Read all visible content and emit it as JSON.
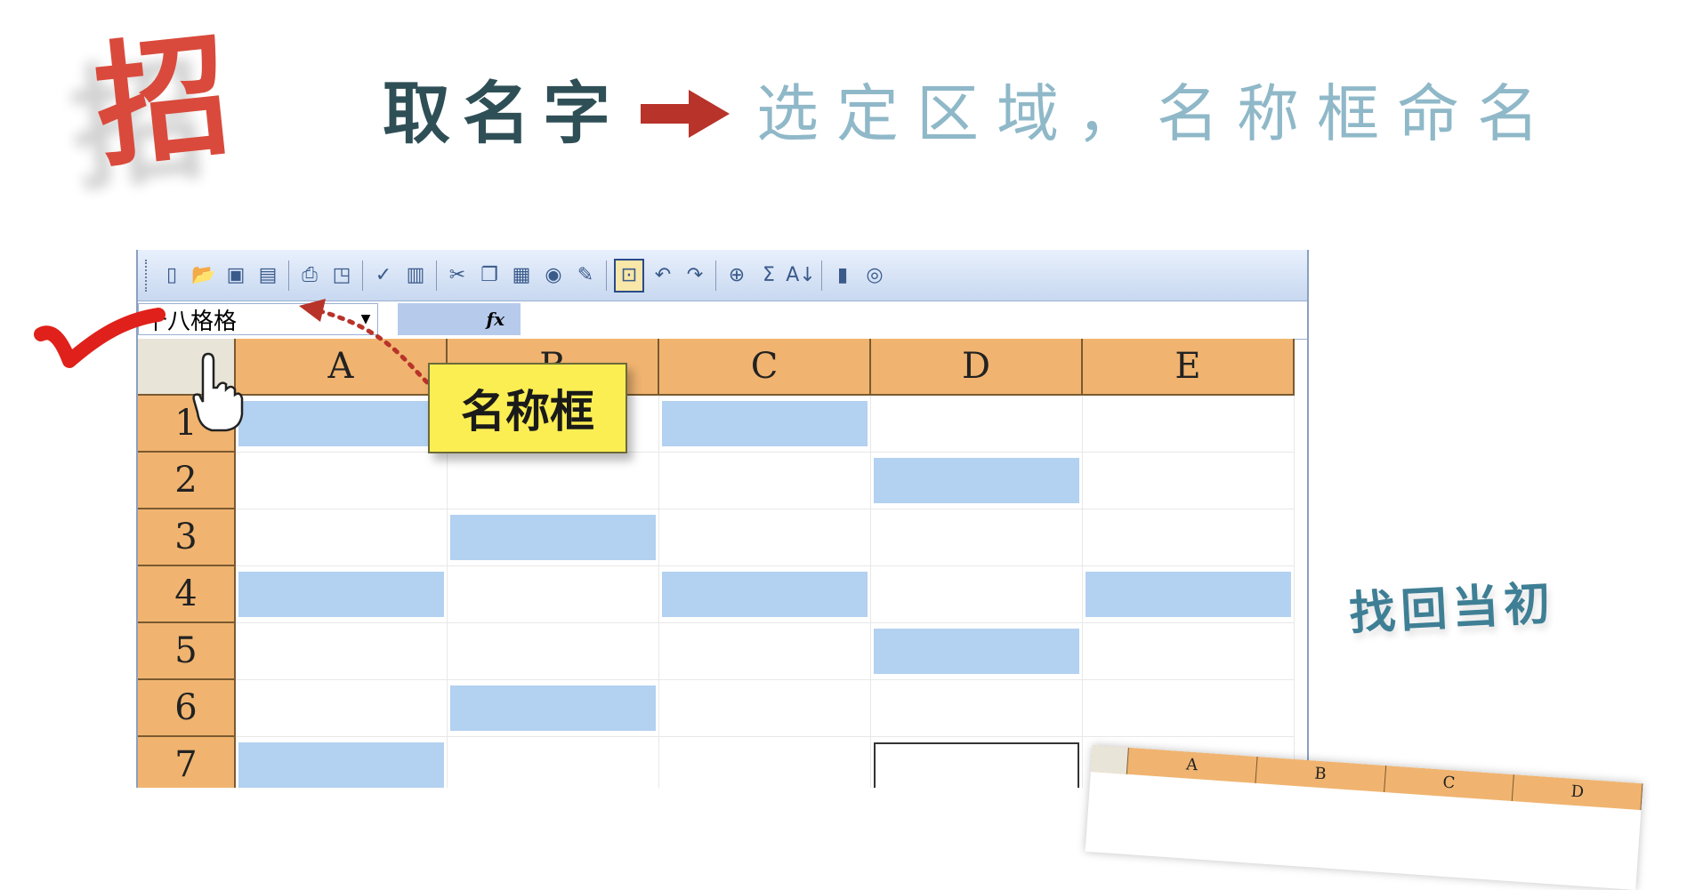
{
  "header": {
    "brand_char": "招",
    "step_text": "取名字",
    "result_text": "选定区域，名称框命名"
  },
  "toolbar": {
    "buttons": [
      "new-icon",
      "open-icon",
      "save-icon",
      "permission-icon",
      "print-icon",
      "print-preview-icon",
      "spelling-icon",
      "research-icon",
      "cut-icon",
      "copy-icon",
      "paste-icon",
      "camera-icon",
      "format-painter-icon",
      "zoom-icon",
      "undo-icon",
      "redo-icon",
      "hyperlink-icon",
      "autosum-icon",
      "sort-ascending-icon",
      "chart-wizard-icon",
      "help-icon"
    ],
    "autosum_glyph": "Σ",
    "sort_glyph": "A↓"
  },
  "formula_bar": {
    "name_box_value": "十八格格",
    "fx_label": "fx"
  },
  "grid": {
    "columns": [
      "A",
      "B",
      "C",
      "D",
      "E"
    ],
    "rows": [
      "1",
      "2",
      "3",
      "4",
      "5",
      "6",
      "7"
    ],
    "highlighted_cells": [
      "A1",
      "C1",
      "D2",
      "B3",
      "A4",
      "C4",
      "E4",
      "D5",
      "B6",
      "A7"
    ],
    "outlined_cells": [
      "D7"
    ],
    "highlight_color": "#b3d1f0",
    "header_color": "#f0b470"
  },
  "annotations": {
    "callout_text": "名称框",
    "side_note": "找回当初",
    "mini_sheet_columns": [
      "A",
      "B",
      "C",
      "D"
    ]
  },
  "colors": {
    "brand": "#d94a3c",
    "step": "#2f4f56",
    "result": "#8fb8c8",
    "arrow": "#b8332a",
    "callout": "#fbee53",
    "check": "#e0201a"
  }
}
